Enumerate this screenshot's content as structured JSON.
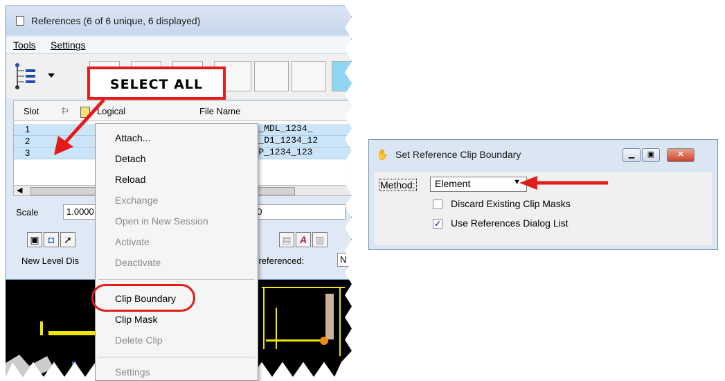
{
  "references_window": {
    "title": "References (6 of 6 unique, 6 displayed)",
    "menu": [
      "Tools",
      "Settings"
    ],
    "columns": [
      "Slot",
      "Logical",
      "File Name"
    ],
    "rows": [
      {
        "slot": "1",
        "file": "MST_MDL_1234_"
      },
      {
        "slot": "2",
        "file": "ASV_D1_1234_12"
      },
      {
        "slot": "3",
        "file": "_SSP_1234_123"
      }
    ],
    "scale_label": "Scale",
    "scale_value": "1.0000",
    "scale_value2": "00",
    "new_level_label": "New Level Dis",
    "georef_label": "eoreferenced:",
    "georef_value": "N"
  },
  "callout": {
    "text": "SELECT ALL",
    "color": "#e41b1b"
  },
  "context_menu": {
    "items": [
      {
        "label": "Attach...",
        "enabled": true
      },
      {
        "label": "Detach",
        "enabled": true
      },
      {
        "label": "Reload",
        "enabled": true
      },
      {
        "label": "Exchange",
        "enabled": false
      },
      {
        "label": "Open in New Session",
        "enabled": false
      },
      {
        "label": "Activate",
        "enabled": false
      },
      {
        "label": "Deactivate",
        "enabled": false
      },
      {
        "label": "Clip Boundary",
        "enabled": true,
        "highlighted": true
      },
      {
        "label": "Clip Mask",
        "enabled": true
      },
      {
        "label": "Delete Clip",
        "enabled": false
      },
      {
        "label": "Settings",
        "enabled": false
      }
    ]
  },
  "clip_dialog": {
    "title": "Set Reference Clip Boundary",
    "method_label": "Method:",
    "method_value": "Element",
    "checkboxes": [
      {
        "label": "Discard Existing Clip Masks",
        "checked": false
      },
      {
        "label": "Use References Dialog List",
        "checked": true
      }
    ]
  },
  "icons": [
    "document-icon",
    "hand-icon",
    "tree-list-icon",
    "dropdown-arrow-icon",
    "minimize-icon",
    "maximize-icon",
    "close-icon"
  ]
}
